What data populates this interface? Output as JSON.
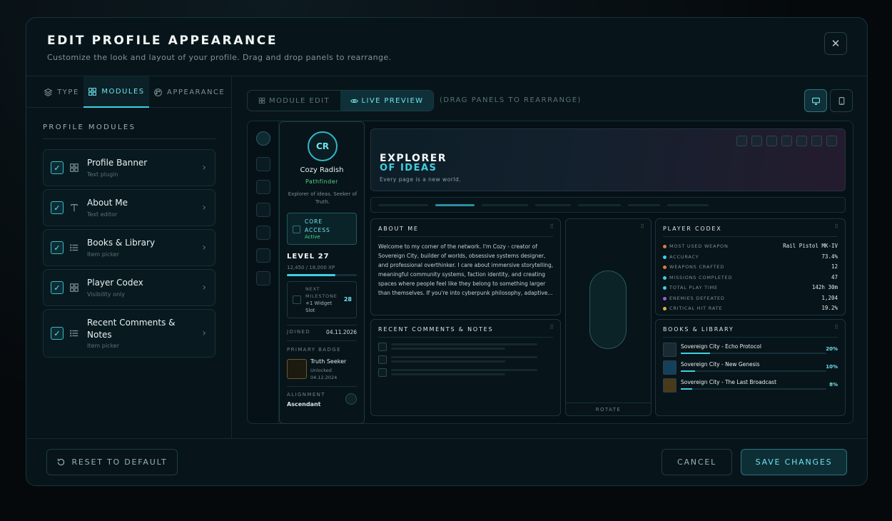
{
  "modal": {
    "title": "EDIT PROFILE APPEARANCE",
    "subtitle": "Customize the look and layout of your profile. Drag and drop panels to rearrange."
  },
  "tabs": [
    {
      "label": "TYPE",
      "icon": "layers-icon"
    },
    {
      "label": "MODULES",
      "icon": "grid-icon",
      "active": true
    },
    {
      "label": "APPEARANCE",
      "icon": "palette-icon"
    }
  ],
  "modules_heading": "PROFILE MODULES",
  "modules": [
    {
      "name": "Profile Banner",
      "sub": "Text plugin",
      "icon": "grid-icon",
      "checked": true
    },
    {
      "name": "About Me",
      "sub": "Text editor",
      "icon": "text-icon",
      "checked": true
    },
    {
      "name": "Books & Library",
      "sub": "Item picker",
      "icon": "list-icon",
      "checked": true
    },
    {
      "name": "Player Codex",
      "sub": "Visibility only",
      "icon": "grid-icon",
      "checked": true
    },
    {
      "name": "Recent Comments & Notes",
      "sub": "Item picker",
      "icon": "list-icon",
      "checked": true
    }
  ],
  "view_toggle": {
    "edit": "MODULE EDIT",
    "preview": "LIVE PREVIEW",
    "hint": "(DRAG PANELS TO REARRANGE)"
  },
  "profile": {
    "initials": "CR",
    "name": "Cozy Radish",
    "rank": "Pathfinder",
    "tagline": "Explorer of ideas. Seeker of Truth.",
    "access_title": "CORE ACCESS",
    "access_status": "Active",
    "level": "LEVEL 27",
    "xp": "12,450 / 18,000 XP",
    "xp_fraction": 0.69,
    "milestone_label": "NEXT MILESTONE",
    "milestone_reward": "+1 Widget Slot",
    "milestone_level": "28",
    "joined_label": "JOINED",
    "joined": "04.11.2026",
    "badge_label": "PRIMARY BADGE",
    "badge_name": "Truth Seeker",
    "badge_status": "Unlocked",
    "badge_date": "04.12.2024",
    "alignment_label": "ALIGNMENT",
    "alignment": "Ascendant"
  },
  "banner": {
    "line1": "EXPLORER",
    "line2": "OF IDEAS",
    "tagline": "Every page is a new world."
  },
  "about": {
    "title": "ABOUT ME",
    "text": "Welcome to my corner of the network. I'm Cozy - creator of Sovereign City, builder of worlds, obsessive systems designer, and professional overthinker. I care about immersive storytelling, meaningful community systems, faction identity, and creating spaces where people feel like they belong to something larger than themselves. If you're into cyberpunk philosophy, adaptive..."
  },
  "comments": {
    "title": "RECENT COMMENTS & NOTES"
  },
  "rotate_label": "ROTATE",
  "codex": {
    "title": "PLAYER CODEX",
    "rows": [
      {
        "label": "MOST USED WEAPON",
        "value": "Rail Pistol MK-IV",
        "color": "#e07a3a"
      },
      {
        "label": "ACCURACY",
        "value": "73.4%",
        "color": "#3fd0e2"
      },
      {
        "label": "WEAPONS CRAFTED",
        "value": "12",
        "color": "#e07a3a"
      },
      {
        "label": "MISSIONS COMPLETED",
        "value": "47",
        "color": "#3fd0e2"
      },
      {
        "label": "TOTAL PLAY TIME",
        "value": "142h 30m",
        "color": "#3fd0e2"
      },
      {
        "label": "ENEMIES DEFEATED",
        "value": "1,204",
        "color": "#a259d9"
      },
      {
        "label": "CRITICAL HIT RATE",
        "value": "19.2%",
        "color": "#e0b43a"
      }
    ]
  },
  "books": {
    "title": "BOOKS & LIBRARY",
    "items": [
      {
        "title": "Sovereign City - Echo Protocol",
        "pct": "20%",
        "fraction": 0.2
      },
      {
        "title": "Sovereign City - New Genesis",
        "pct": "10%",
        "fraction": 0.1
      },
      {
        "title": "Sovereign City - The Last Broadcast",
        "pct": "8%",
        "fraction": 0.08
      }
    ]
  },
  "footer": {
    "reset": "RESET TO DEFAULT",
    "cancel": "CANCEL",
    "save": "SAVE CHANGES"
  },
  "colors": {
    "accent": "#3fd0e2",
    "success": "#4fd68a",
    "background": "#07151a"
  }
}
